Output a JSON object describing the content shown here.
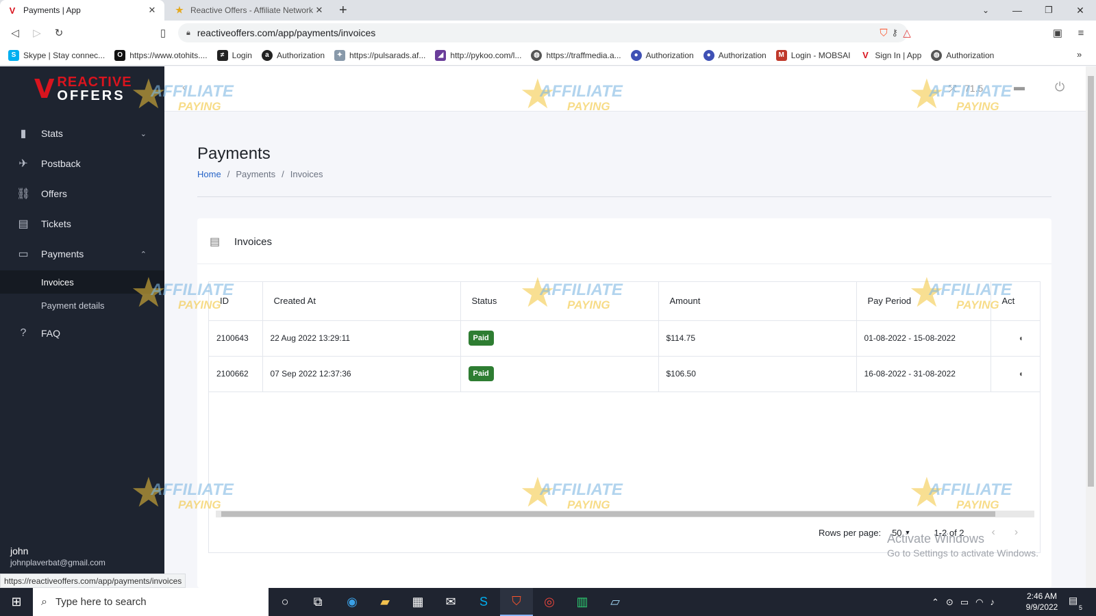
{
  "browser": {
    "tabs": [
      {
        "title": "Payments | App",
        "favicon": "reactive-offers-logo-icon",
        "active": true
      },
      {
        "title": "Reactive Offers - Affiliate Network Rev",
        "favicon": "affiliate-paying-star-icon",
        "active": false
      }
    ],
    "url": "reactiveoffers.com/app/payments/invoices",
    "bookmarks": [
      {
        "label": "Skype | Stay connec...",
        "color": "#00aff0"
      },
      {
        "label": "https://www.otohits....",
        "color": "#111111"
      },
      {
        "label": "Login",
        "color": "#222222"
      },
      {
        "label": "Authorization",
        "color": "#222222"
      },
      {
        "label": "https://pulsarads.af...",
        "color": "#8899aa"
      },
      {
        "label": "http://pykoo.com/l...",
        "color": "#6a3d9a"
      },
      {
        "label": "https://traffmedia.a...",
        "color": "#555555"
      },
      {
        "label": "Authorization",
        "color": "#3f51b5"
      },
      {
        "label": "Authorization",
        "color": "#3f51b5"
      },
      {
        "label": "Login - MOBSAI",
        "color": "#c0392b"
      },
      {
        "label": "Sign In | App",
        "color": "#d9141e"
      },
      {
        "label": "Authorization",
        "color": "#555555"
      }
    ],
    "status_url": "https://reactiveoffers.com/app/payments/invoices"
  },
  "logo": {
    "line1": "REACTIVE",
    "line2": "OFFERS"
  },
  "sidebar": {
    "items": [
      {
        "label": "Stats",
        "icon": "bar-chart-icon",
        "chevron": "⌄"
      },
      {
        "label": "Postback",
        "icon": "airplane-icon",
        "chevron": ""
      },
      {
        "label": "Offers",
        "icon": "link-icon",
        "chevron": ""
      },
      {
        "label": "Tickets",
        "icon": "chat-icon",
        "chevron": ""
      },
      {
        "label": "Payments",
        "icon": "credit-card-icon",
        "chevron": "⌃"
      }
    ],
    "sub_items": [
      {
        "label": "Invoices",
        "active": true
      },
      {
        "label": "Payment details",
        "active": false
      }
    ],
    "faq": {
      "label": "FAQ",
      "icon": "help-circle-icon"
    },
    "user": {
      "name": "john",
      "email": "johnplaverbat@gmail.com"
    }
  },
  "topbar": {
    "balance": "71.5"
  },
  "page": {
    "title": "Payments",
    "breadcrumb": {
      "home": "Home",
      "section": "Payments",
      "current": "Invoices"
    }
  },
  "card": {
    "title": "Invoices",
    "columns": [
      "ID",
      "Created At",
      "Status",
      "Amount",
      "Pay Period",
      "Act"
    ],
    "rows": [
      {
        "id": "2100643",
        "created_at": "22 Aug 2022 13:29:11",
        "status": "Paid",
        "amount": "$114.75",
        "pay_period": "01-08-2022 - 15-08-2022"
      },
      {
        "id": "2100662",
        "created_at": "07 Sep 2022 12:37:36",
        "status": "Paid",
        "amount": "$106.50",
        "pay_period": "16-08-2022 - 31-08-2022"
      }
    ],
    "pagination": {
      "rows_label": "Rows per page:",
      "rows_value": "50",
      "range": "1-2 of 2"
    }
  },
  "watermark": {
    "line1": "AFFILIATE",
    "line2": "PAYING"
  },
  "activate_windows": {
    "line1": "Activate Windows",
    "line2": "Go to Settings to activate Windows."
  },
  "taskbar": {
    "search_placeholder": "Type here to search",
    "time": "2:46 AM",
    "date": "9/9/2022",
    "notifications": "5"
  },
  "colors": {
    "sidebar": "#1e2430",
    "paid_badge": "#2e7d32",
    "brand_red": "#d9141e"
  }
}
